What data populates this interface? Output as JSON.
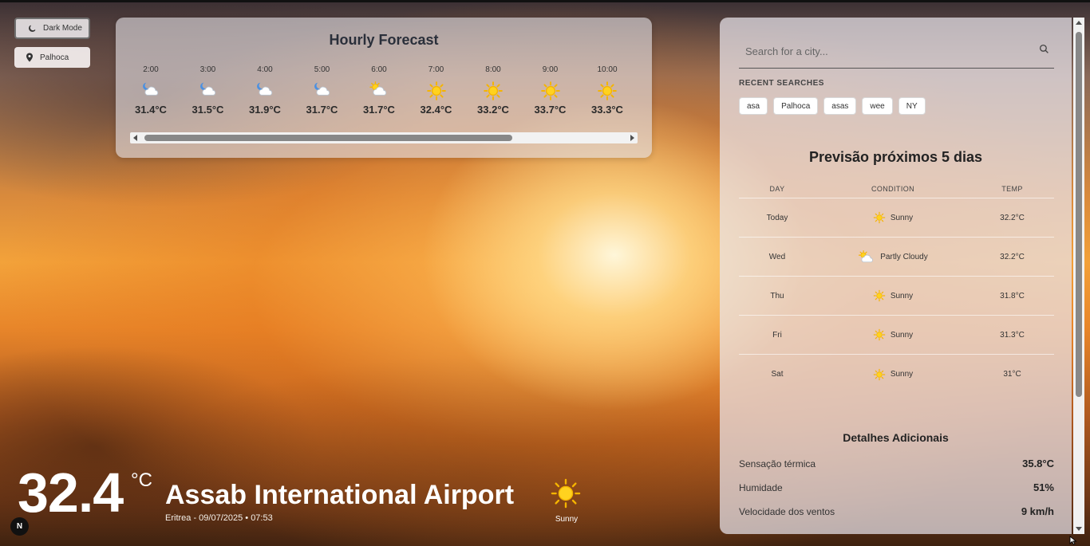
{
  "controls": {
    "dark_mode_label": "Dark Mode",
    "location_label": "Palhoca"
  },
  "hourly": {
    "title": "Hourly Forecast",
    "items": [
      {
        "time": "2:00",
        "temp": "31.4°C",
        "icon": "moon-cloud-icon"
      },
      {
        "time": "3:00",
        "temp": "31.5°C",
        "icon": "moon-cloud-icon"
      },
      {
        "time": "4:00",
        "temp": "31.9°C",
        "icon": "moon-cloud-icon"
      },
      {
        "time": "5:00",
        "temp": "31.7°C",
        "icon": "moon-cloud-icon"
      },
      {
        "time": "6:00",
        "temp": "31.7°C",
        "icon": "sun-cloud-icon"
      },
      {
        "time": "7:00",
        "temp": "32.4°C",
        "icon": "sun-icon"
      },
      {
        "time": "8:00",
        "temp": "33.2°C",
        "icon": "sun-icon"
      },
      {
        "time": "9:00",
        "temp": "33.7°C",
        "icon": "sun-icon"
      },
      {
        "time": "10:00",
        "temp": "33.3°C",
        "icon": "sun-icon"
      }
    ]
  },
  "search": {
    "placeholder": "Search for a city...",
    "recent_label": "RECENT SEARCHES",
    "recent": [
      "asa",
      "Palhoca",
      "asas",
      "wee",
      "NY"
    ]
  },
  "forecast": {
    "title": "Previsão próximos 5 dias",
    "headers": {
      "day": "DAY",
      "condition": "CONDITION",
      "temp": "TEMP"
    },
    "rows": [
      {
        "day": "Today",
        "condition": "Sunny",
        "temp": "32.2°C",
        "icon": "sun-icon"
      },
      {
        "day": "Wed",
        "condition": "Partly Cloudy",
        "temp": "32.2°C",
        "icon": "sun-cloud-icon"
      },
      {
        "day": "Thu",
        "condition": "Sunny",
        "temp": "31.8°C",
        "icon": "sun-icon"
      },
      {
        "day": "Fri",
        "condition": "Sunny",
        "temp": "31.3°C",
        "icon": "sun-icon"
      },
      {
        "day": "Sat",
        "condition": "Sunny",
        "temp": "31°C",
        "icon": "sun-icon"
      }
    ]
  },
  "details": {
    "title": "Detalhes Adicionais",
    "items": [
      {
        "label": "Sensação térmica",
        "value": "35.8°C"
      },
      {
        "label": "Humidade",
        "value": "51%"
      },
      {
        "label": "Velocidade dos ventos",
        "value": "9 km/h"
      }
    ]
  },
  "current": {
    "temp": "32.4",
    "unit": "°C",
    "location": "Assab International Airport",
    "meta": "Eritrea - 09/07/2025 • 07:53",
    "condition": "Sunny",
    "icon": "sun-icon"
  },
  "badge": "N"
}
